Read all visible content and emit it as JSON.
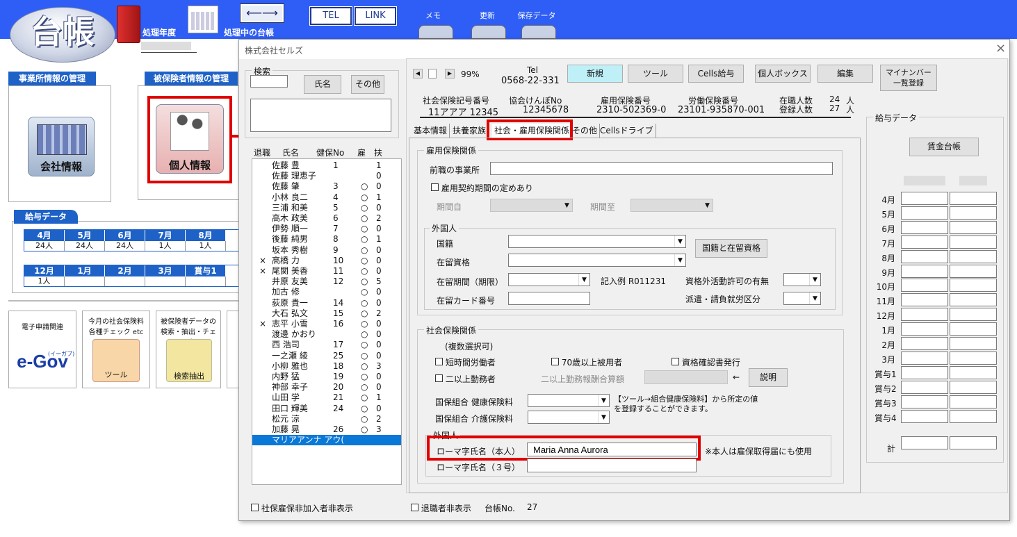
{
  "app": {
    "logo": "台帳",
    "label_year": "処理年度",
    "label_current": "処理中の台帳",
    "btn_tel": "TEL",
    "btn_link": "LINK",
    "tool_memo": "メモ",
    "tool_update": "更新",
    "tool_save": "保存データ",
    "arrows": "⟵⟶"
  },
  "left": {
    "sec_office": "事業所情報の管理",
    "sec_insured": "被保険者情報の管理",
    "office_btn": "会社情報",
    "personal_btn": "個人情報",
    "kyuyo_title": "給与データ",
    "months1": [
      "4月",
      "5月",
      "6月",
      "7月",
      "8月"
    ],
    "vals1": [
      "24人",
      "24人",
      "24人",
      "1人",
      "1人"
    ],
    "months2": [
      "12月",
      "1月",
      "2月",
      "3月",
      "賞与1"
    ],
    "vals2": [
      "1人",
      "",
      "",
      "",
      ""
    ],
    "egov_label": "電子申請関連",
    "egov_logo": "e-Gov",
    "egov_sub": "(イーガブ)",
    "check_label": "今月の社会保険料 各種チェック etc",
    "tool_btn": "ツール",
    "search_label": "被保険者データの 検索・抽出・チェック",
    "search_btn": "検索抽出"
  },
  "dialog": {
    "title": "株式会社セルズ",
    "search_label": "検索",
    "btn_name": "氏名",
    "btn_other": "その他",
    "list_headers": {
      "retire": "退職",
      "name": "氏名",
      "no": "健保No",
      "koyo": "雇",
      "fuyo": "扶"
    },
    "rows": [
      {
        "r": "",
        "name": "佐藤 豊",
        "no": "1",
        "k": "",
        "f": "1"
      },
      {
        "r": "",
        "name": "佐藤 理恵子",
        "no": "",
        "k": "",
        "f": "0"
      },
      {
        "r": "",
        "name": "佐藤 肇",
        "no": "3",
        "k": "○",
        "f": "0"
      },
      {
        "r": "",
        "name": "小林 良二",
        "no": "4",
        "k": "○",
        "f": "1"
      },
      {
        "r": "",
        "name": "三浦 和美",
        "no": "5",
        "k": "○",
        "f": "0"
      },
      {
        "r": "",
        "name": "高木 政美",
        "no": "6",
        "k": "○",
        "f": "2"
      },
      {
        "r": "",
        "name": "伊勢 順一",
        "no": "7",
        "k": "○",
        "f": "0"
      },
      {
        "r": "",
        "name": "後藤 純男",
        "no": "8",
        "k": "○",
        "f": "1"
      },
      {
        "r": "",
        "name": "坂本 秀樹",
        "no": "9",
        "k": "○",
        "f": "0"
      },
      {
        "r": "×",
        "name": "高橋 力",
        "no": "10",
        "k": "○",
        "f": "0"
      },
      {
        "r": "×",
        "name": "尾関 美香",
        "no": "11",
        "k": "○",
        "f": "0"
      },
      {
        "r": "",
        "name": "井原 友美",
        "no": "12",
        "k": "○",
        "f": "5"
      },
      {
        "r": "",
        "name": "加古 修",
        "no": "",
        "k": "○",
        "f": "0"
      },
      {
        "r": "",
        "name": "荻原 貴一",
        "no": "14",
        "k": "○",
        "f": "0"
      },
      {
        "r": "",
        "name": "大石 弘文",
        "no": "15",
        "k": "○",
        "f": "2"
      },
      {
        "r": "×",
        "name": "志平 小雪",
        "no": "16",
        "k": "○",
        "f": "0"
      },
      {
        "r": "",
        "name": "渡邊 かおり",
        "no": "",
        "k": "○",
        "f": "0"
      },
      {
        "r": "",
        "name": "西 浩司",
        "no": "17",
        "k": "○",
        "f": "0"
      },
      {
        "r": "",
        "name": "一之瀬 綾",
        "no": "25",
        "k": "○",
        "f": "0"
      },
      {
        "r": "",
        "name": "小柳 雅也",
        "no": "18",
        "k": "○",
        "f": "3"
      },
      {
        "r": "",
        "name": "内野 猛",
        "no": "19",
        "k": "○",
        "f": "0"
      },
      {
        "r": "",
        "name": "神部 幸子",
        "no": "20",
        "k": "○",
        "f": "0"
      },
      {
        "r": "",
        "name": "山田 学",
        "no": "21",
        "k": "○",
        "f": "1"
      },
      {
        "r": "",
        "name": "田口 輝美",
        "no": "24",
        "k": "○",
        "f": "0"
      },
      {
        "r": "",
        "name": "松元 涼",
        "no": "",
        "k": "○",
        "f": "2"
      },
      {
        "r": "",
        "name": "加藤 晃",
        "no": "26",
        "k": "○",
        "f": "3"
      },
      {
        "r": "",
        "name": "マリアアンナ アウ(",
        "no": "",
        "k": "",
        "f": ""
      }
    ],
    "chk_hide_nonmember": "社保雇保非加入者非表示",
    "chk_hide_retired": "退職者非表示",
    "daicho_no_label": "台帳No.",
    "daicho_no": "27",
    "zoom": "99%",
    "tel_label": "Tel",
    "tel": "0568-22-331",
    "btn_new": "新規",
    "btn_tool": "ツール",
    "btn_cells": "Cells給与",
    "btn_box": "個人ボックス",
    "btn_edit": "編集",
    "btn_mynumber": "マイナンバー 一覧登録",
    "h_shaho": "社会保険記号番号",
    "v_shaho": "11アアア 12345",
    "h_kyokai": "協会けんぽNo",
    "v_kyokai": "12345678",
    "h_koyo": "雇用保険番号",
    "v_koyo": "2310-502369-0",
    "h_rodo": "労働保険番号",
    "v_rodo": "23101-935870-001",
    "h_zaishoku": "在職人数",
    "v_zaishoku": "24",
    "h_toroku": "登録人数",
    "v_toroku": "27",
    "unit_nin": "人",
    "tabs": [
      "基本情報",
      "扶養家族",
      "社会・雇用保険関係",
      "その他",
      "Cellsドライブ"
    ],
    "g_koyo": "雇用保険関係",
    "prev_office": "前職の事業所",
    "chk_keiyaku": "雇用契約期間の定めあり",
    "kikan_from": "期間自",
    "kikan_to": "期間至",
    "g_gaikoku": "外国人",
    "kokuseki": "国籍",
    "btn_kokuseki": "国籍と在留資格",
    "zairyu_shikaku": "在留資格",
    "zairyu_kikan": "在留期間（期限）",
    "kinyurei": "記入例  R011231",
    "shikakugai": "資格外活動許可の有無",
    "zairyu_card": "在留カード番号",
    "haken": "派遣・請負就労区分",
    "g_shaho": "社会保険関係",
    "fukusu": "(複数選択可)",
    "chk_tanjikan": "短時間労働者",
    "chk_70": "70歳以上被用者",
    "chk_shikaku": "資格確認書発行",
    "chk_niijo": "二以上勤務者",
    "niijo_gaku": "二以上勤務報酬合算額",
    "arrow_left": "←",
    "btn_setsumei": "説明",
    "kenpo_lbl": "国保組合  健康保険料",
    "kaigo_lbl": "国保組合  介護保険料",
    "kenpo_note": "【ツール→組合健康保険料】から所定の値 を登録することができます。",
    "g_gaikoku2": "外国人",
    "romaji_honnin": "ローマ字氏名（本人）",
    "romaji_value": "Maria Anna Aurora",
    "romaji_note": "※本人は雇保取得届にも使用",
    "romaji_3go": "ローマ字氏名（３号）",
    "kyuyo_title": "給与データ",
    "btn_chingin": "賃金台帳",
    "months": [
      "4月",
      "5月",
      "6月",
      "7月",
      "8月",
      "9月",
      "10月",
      "11月",
      "12月",
      "1月",
      "2月",
      "3月",
      "賞与1",
      "賞与2",
      "賞与3",
      "賞与4"
    ],
    "total": "計"
  },
  "colors": {
    "blue": "#2e5ef5",
    "accent": "#e00000",
    "selected": "#0a78d7",
    "new_btn": "#bff0f7"
  }
}
